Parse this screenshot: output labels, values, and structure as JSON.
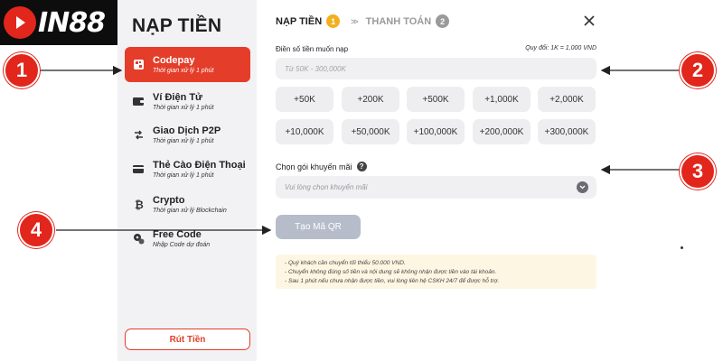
{
  "logo": {
    "text": "IN88"
  },
  "sidebar": {
    "title": "NẠP TIỀN",
    "items": [
      {
        "name": "Codepay",
        "sub": "Thời gian xử lý 1 phút",
        "icon": "codepay-icon",
        "active": true
      },
      {
        "name": "Ví Điện Tử",
        "sub": "Thời gian xử lý 1 phút",
        "icon": "wallet-icon",
        "active": false
      },
      {
        "name": "Giao Dịch P2P",
        "sub": "Thời gian xử lý 1 phút",
        "icon": "p2p-icon",
        "active": false
      },
      {
        "name": "Thẻ Cào Điện Thoại",
        "sub": "Thời gian xử lý 1 phút",
        "icon": "card-icon",
        "active": false
      },
      {
        "name": "Crypto",
        "sub": "Thời gian xử lý Blockchain",
        "icon": "bitcoin-icon",
        "active": false
      },
      {
        "name": "Free Code",
        "sub": "Nhập Code dự đoán",
        "icon": "gift-icon",
        "active": false
      }
    ],
    "withdraw_label": "Rút Tiền"
  },
  "main": {
    "step1": {
      "label": "NẠP TIỀN",
      "num": "1"
    },
    "step2": {
      "label": "THANH TOÁN",
      "num": "2"
    },
    "separator": ">>",
    "amount_label": "Điền số tiền muốn nạp",
    "rate": "Quy đổi: 1K = 1,000 VND",
    "amount_placeholder": "Từ 50K - 300,000K",
    "amount_value": "",
    "chips": [
      "+50K",
      "+200K",
      "+500K",
      "+1,000K",
      "+2,000K",
      "+10,000K",
      "+50,000K",
      "+100,000K",
      "+200,000K",
      "+300,000K"
    ],
    "promo_label": "Chọn gói khuyến mãi",
    "help_glyph": "?",
    "promo_placeholder": "Vui lòng chọn khuyến mãi",
    "qr_button": "Tạo Mã QR",
    "notes": [
      "Quý khách cần chuyển tối thiểu 50.000 VND.",
      "Chuyển không đúng số tiền và nội dung sẽ không nhận được tiền vào tài khoản.",
      "Sau 1 phút nếu chưa nhận được tiền, vui lòng liên hệ CSKH 24/7 để được hỗ trợ."
    ]
  },
  "annotations": [
    "1",
    "2",
    "3",
    "4"
  ],
  "colors": {
    "accent": "#e43d2a",
    "step_active": "#f2b01e",
    "step_inactive": "#9a9a9a",
    "button_disabled": "#b6bcc9",
    "notes_bg": "#fdf6e3"
  }
}
